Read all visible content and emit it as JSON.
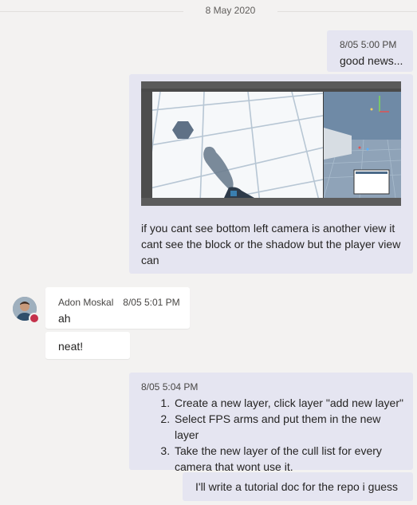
{
  "date_separator": "8 May 2020",
  "messages": [
    {
      "timestamp": "8/05 5:00 PM",
      "text": "good news..."
    },
    {
      "caption": "if you cant see bottom left camera is another view it cant see the block or the shadow but the player view can"
    },
    {
      "author": "Adon Moskal",
      "timestamp": "8/05 5:01 PM",
      "text": "ah"
    },
    {
      "text": "neat!"
    },
    {
      "timestamp": "8/05 5:04 PM",
      "steps": [
        "Create a new layer, click layer \"add new layer\"",
        "Select FPS arms and put them in the new layer",
        "Take the new layer of the cull list for every camera that wont use it."
      ]
    },
    {
      "text": "I'll write a tutorial doc for the repo i guess"
    }
  ],
  "colors": {
    "background": "#f3f2f1",
    "my_bubble": "#e5e5f1",
    "other_bubble": "#ffffff",
    "presence_busy": "#c4314b"
  }
}
